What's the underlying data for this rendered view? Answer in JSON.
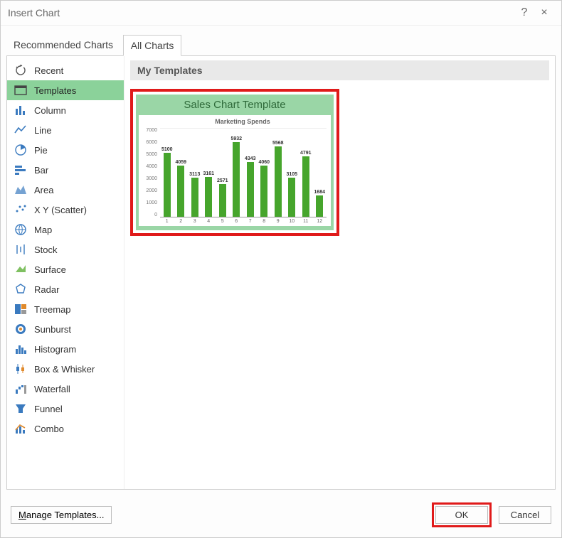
{
  "dialog": {
    "title": "Insert Chart",
    "help_tooltip": "?",
    "close_tooltip": "×"
  },
  "tabs": {
    "recommended": "Recommended Charts",
    "all": "All Charts"
  },
  "sidebar": {
    "items": [
      {
        "label": "Recent"
      },
      {
        "label": "Templates"
      },
      {
        "label": "Column"
      },
      {
        "label": "Line"
      },
      {
        "label": "Pie"
      },
      {
        "label": "Bar"
      },
      {
        "label": "Area"
      },
      {
        "label": "X Y (Scatter)"
      },
      {
        "label": "Map"
      },
      {
        "label": "Stock"
      },
      {
        "label": "Surface"
      },
      {
        "label": "Radar"
      },
      {
        "label": "Treemap"
      },
      {
        "label": "Sunburst"
      },
      {
        "label": "Histogram"
      },
      {
        "label": "Box & Whisker"
      },
      {
        "label": "Waterfall"
      },
      {
        "label": "Funnel"
      },
      {
        "label": "Combo"
      }
    ],
    "selected_index": 1
  },
  "main": {
    "section_title": "My Templates",
    "template": {
      "title": "Sales Chart Template",
      "subtitle": "Marketing Spends"
    }
  },
  "footer": {
    "manage": "Manage Templates...",
    "ok": "OK",
    "cancel": "Cancel"
  },
  "chart_data": {
    "type": "bar",
    "title": "Sales Chart Template",
    "subtitle": "Marketing Spends",
    "categories": [
      "1",
      "2",
      "3",
      "4",
      "5",
      "6",
      "7",
      "8",
      "9",
      "10",
      "11",
      "12"
    ],
    "values": [
      5100,
      4059,
      3113,
      3161,
      2571,
      5932,
      4343,
      4060,
      5568,
      3105,
      4791,
      1684
    ],
    "xlabel": "",
    "ylabel": "",
    "ylim": [
      0,
      7000
    ],
    "yticks": [
      0,
      1000,
      2000,
      3000,
      4000,
      5000,
      6000,
      7000
    ],
    "color": "#46a52c"
  }
}
